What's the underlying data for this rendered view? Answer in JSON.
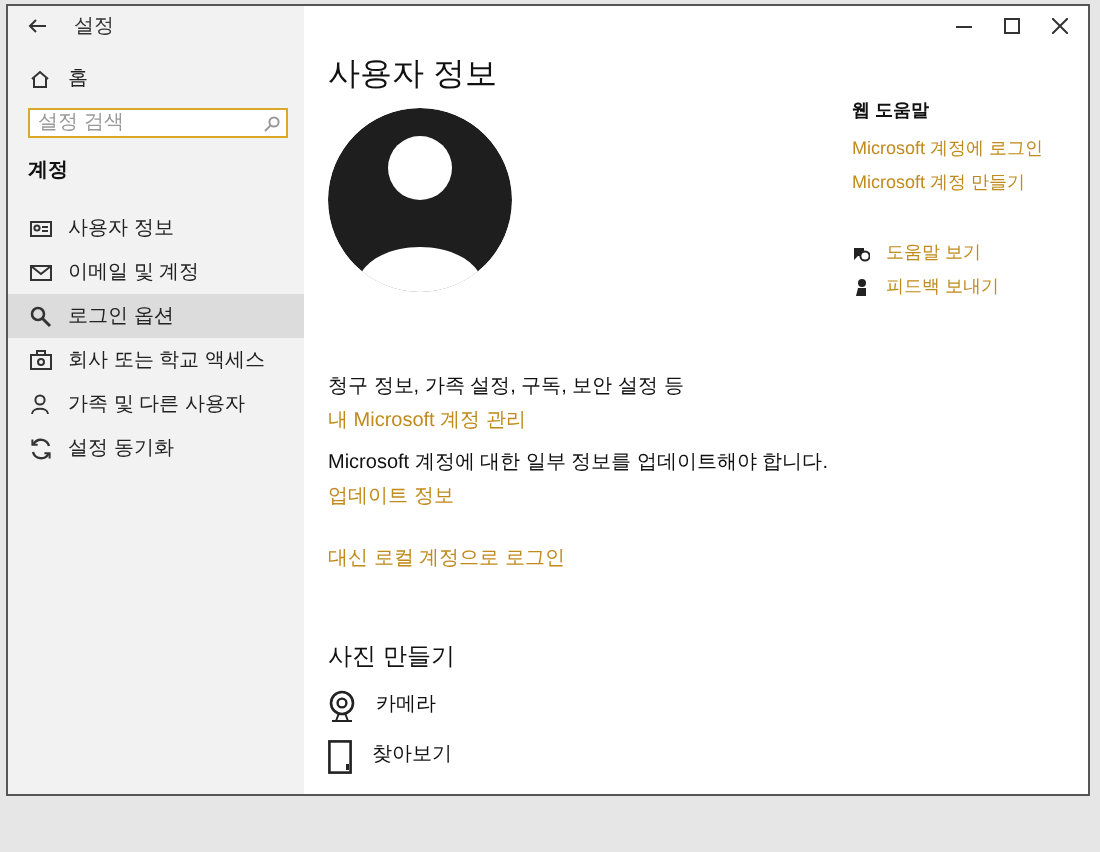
{
  "window": {
    "title": "설정"
  },
  "sidebar": {
    "home": "홈",
    "search": {
      "placeholder": "설정 검색"
    },
    "section": "계정",
    "items": [
      {
        "label": "사용자 정보",
        "selected": false
      },
      {
        "label": "이메일 및 계정",
        "selected": false
      },
      {
        "label": "로그인 옵션",
        "selected": true
      },
      {
        "label": "회사 또는 학교 액세스",
        "selected": false
      },
      {
        "label": "가족 및 다른 사용자",
        "selected": false
      },
      {
        "label": "설정 동기화",
        "selected": false
      }
    ]
  },
  "main": {
    "title": "사용자 정보",
    "account_text": "청구 정보, 가족 설정, 구독, 보안 설정 등",
    "manage_link": "내 Microsoft 계정 관리",
    "update_text": "Microsoft 계정에 대한 일부 정보를 업데이트해야 합니다.",
    "update_link": "업데이트 정보",
    "local_link": "대신 로컬 계정으로 로그인",
    "photo_heading": "사진 만들기",
    "photo_options": [
      "카메라",
      "찾아보기"
    ]
  },
  "help": {
    "heading": "웹 도움말",
    "links": [
      "Microsoft 계정에 로그인",
      "Microsoft 계정 만들기"
    ],
    "actions": [
      "도움말 보기",
      "피드백 보내기"
    ]
  }
}
